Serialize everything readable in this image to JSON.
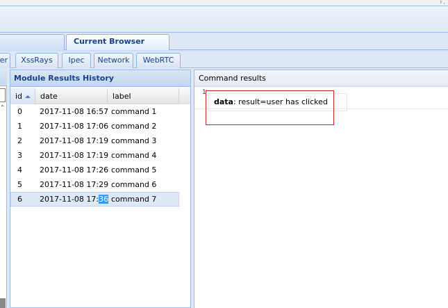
{
  "main_tabs": [
    {
      "label": "",
      "active": false
    },
    {
      "label": "Current Browser",
      "active": true
    }
  ],
  "sub_tabs": [
    {
      "label": "er"
    },
    {
      "label": "XssRays"
    },
    {
      "label": "Ipec"
    },
    {
      "label": "Network"
    },
    {
      "label": "WebRTC"
    }
  ],
  "module_results": {
    "title": "Module Results History",
    "columns": {
      "id": "id",
      "date": "date",
      "label": "label"
    },
    "rows": [
      {
        "id": "0",
        "date": "2017-11-08 16:57",
        "label": "command 1"
      },
      {
        "id": "1",
        "date": "2017-11-08 17:06",
        "label": "command 2"
      },
      {
        "id": "2",
        "date": "2017-11-08 17:19",
        "label": "command 3"
      },
      {
        "id": "3",
        "date": "2017-11-08 17:19",
        "label": "command 4"
      },
      {
        "id": "4",
        "date": "2017-11-08 17:26",
        "label": "command 5"
      },
      {
        "id": "5",
        "date": "2017-11-08 17:29",
        "label": "command 6"
      },
      {
        "id": "6",
        "date_prefix": "2017-11-08 17:",
        "date_selected": "36",
        "label": "command 7"
      }
    ]
  },
  "command_results": {
    "title": "Command results",
    "row_number": "1",
    "key": "data",
    "value": ": result=user has clicked"
  },
  "topbar": {
    "mark": "ı ,"
  },
  "colors": {
    "accent": "#15428b",
    "border": "#99bbe8",
    "highlight_box": "#cc2222",
    "text_selection": "#3399ff"
  }
}
